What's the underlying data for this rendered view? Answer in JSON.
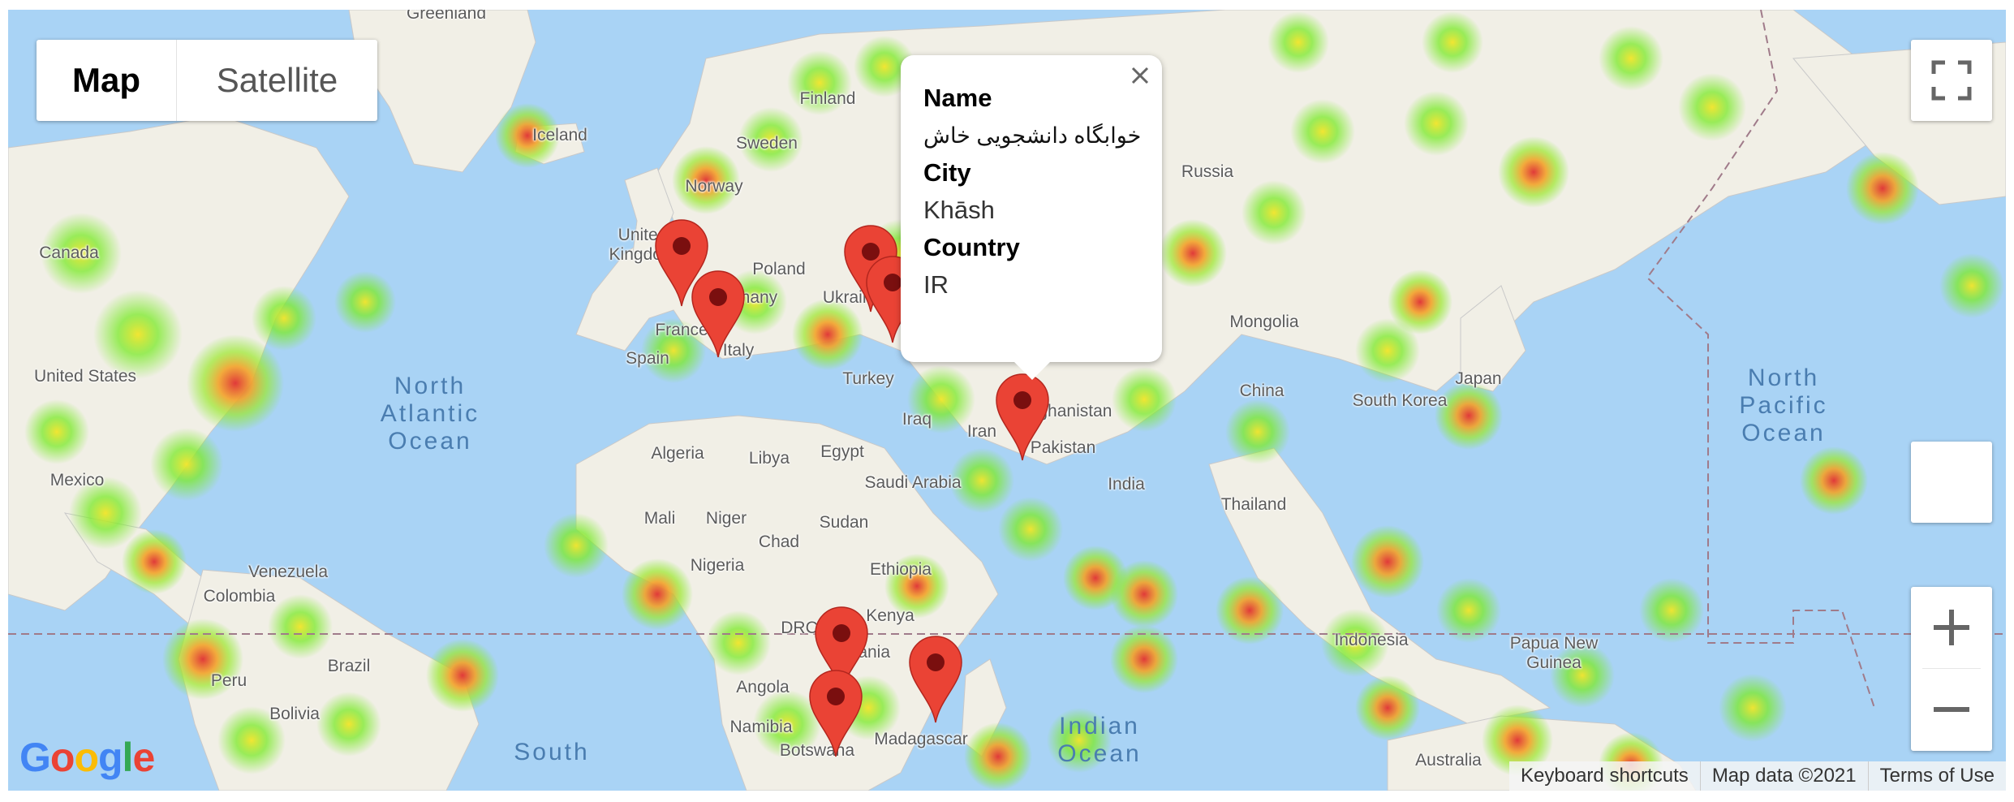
{
  "map_type": {
    "map_label": "Map",
    "satellite_label": "Satellite"
  },
  "infowindow": {
    "name_label": "Name",
    "name_value": "خوابگاه دانشجویی خاش",
    "city_label": "City",
    "city_value": "Khāsh",
    "country_label": "Country",
    "country_value": "IR"
  },
  "attribution": {
    "shortcuts": "Keyboard shortcuts",
    "map_data": "Map data ©2021",
    "terms": "Terms of Use"
  },
  "logo_text": "Google",
  "map_labels": {
    "greenland": "Greenland",
    "iceland": "Iceland",
    "finland": "Finland",
    "sweden": "Sweden",
    "norway": "Norway",
    "russia": "Russia",
    "canada": "Canada",
    "united_kingdom": "United\nKingdom",
    "poland": "Poland",
    "ukraine": "Ukraine",
    "germany": "Germany",
    "france": "France",
    "italy": "Italy",
    "spain": "Spain",
    "united_states": "United States",
    "mongolia": "Mongolia",
    "turkey": "Turkey",
    "iraq": "Iraq",
    "iran": "Iran",
    "afghanistan": "Afghanistan",
    "pakistan": "Pakistan",
    "china": "China",
    "south_korea": "South Korea",
    "japan": "Japan",
    "algeria": "Algeria",
    "libya": "Libya",
    "egypt": "Egypt",
    "saudi_arabia": "Saudi Arabia",
    "india": "India",
    "thailand": "Thailand",
    "mexico": "Mexico",
    "mali": "Mali",
    "niger": "Niger",
    "sudan": "Sudan",
    "chad": "Chad",
    "nigeria": "Nigeria",
    "ethiopia": "Ethiopia",
    "venezuela": "Venezuela",
    "colombia": "Colombia",
    "kenya": "Kenya",
    "drc": "DRC",
    "tanzania": "Tanzania",
    "angola": "Angola",
    "brazil": "Brazil",
    "peru": "Peru",
    "bolivia": "Bolivia",
    "namibia": "Namibia",
    "botswana": "Botswana",
    "madagascar": "Madagascar",
    "indonesia": "Indonesia",
    "papua_new_guinea": "Papua New\nGuinea",
    "australia": "Australia",
    "north_atlantic": "North\nAtlantic\nOcean",
    "north_pacific": "North\nPacific\nOcean",
    "indian_ocean": "Indian\nOcean",
    "south": "South"
  },
  "colors": {
    "water": "#a9d3f5",
    "land": "#f1efe6",
    "heat_low": "#7bea2a",
    "heat_mid": "#f2e529",
    "heat_high": "#e03a3a",
    "marker": "#ea4335"
  }
}
